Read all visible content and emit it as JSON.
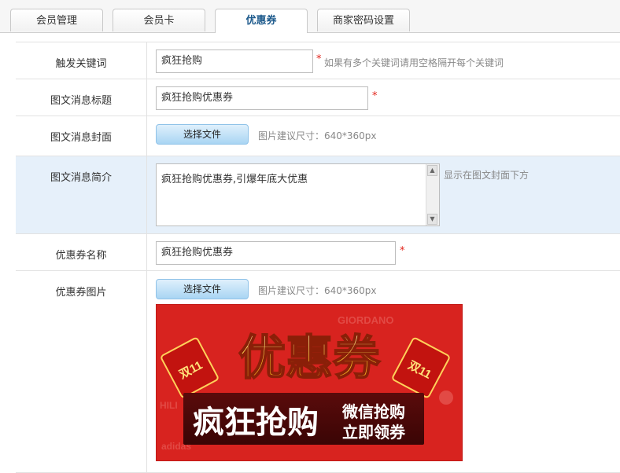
{
  "tabs": [
    {
      "label": "会员管理",
      "active": false
    },
    {
      "label": "会员卡",
      "active": false
    },
    {
      "label": "优惠券",
      "active": true
    },
    {
      "label": "商家密码设置",
      "active": false
    }
  ],
  "form": {
    "keyword": {
      "label": "触发关键词",
      "value": "疯狂抢购",
      "required": "*",
      "hint": "如果有多个关键词请用空格隔开每个关键词"
    },
    "news_title": {
      "label": "图文消息标题",
      "value": "疯狂抢购优惠券",
      "required": "*"
    },
    "news_cover": {
      "label": "图文消息封面",
      "button": "选择文件",
      "hint": "图片建议尺寸：640*360px"
    },
    "news_summary": {
      "label": "图文消息简介",
      "value": "疯狂抢购优惠券,引爆年底大优惠",
      "hint": "显示在图文封面下方"
    },
    "coupon_name": {
      "label": "优惠券名称",
      "value": "疯狂抢购优惠券",
      "required": "*"
    },
    "coupon_image": {
      "label": "优惠券图片",
      "button": "选择文件",
      "hint": "图片建议尺寸：640*360px",
      "banner": {
        "title": "优惠券",
        "slogan": "疯狂抢购",
        "side_line1": "微信抢购",
        "side_line2": "立即领券",
        "tag": "双11"
      }
    }
  },
  "colors": {
    "accent": "#1d5a8c",
    "required": "#e2231a",
    "highlight_row": "#e6f0fa",
    "banner_red": "#d8231f"
  }
}
